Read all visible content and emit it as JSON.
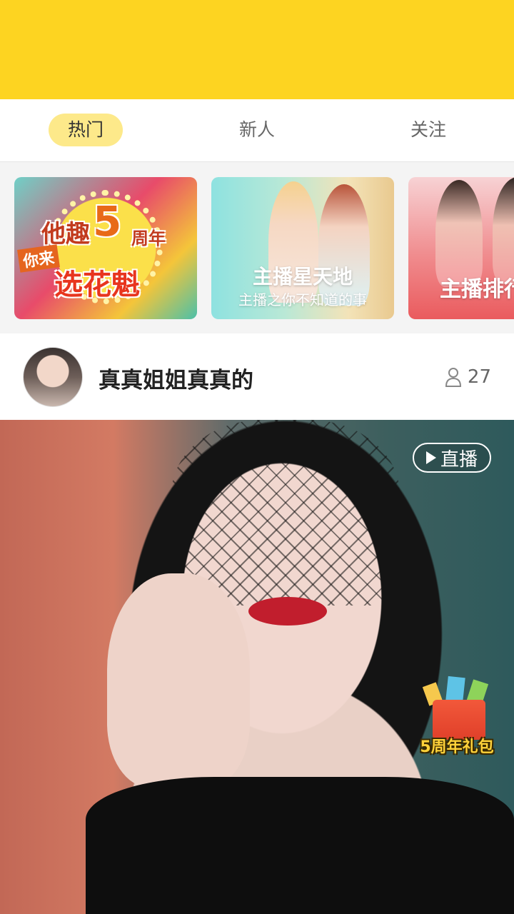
{
  "tabs": [
    {
      "label": "热门",
      "active": true
    },
    {
      "label": "新人",
      "active": false
    },
    {
      "label": "关注",
      "active": false
    }
  ],
  "banners": {
    "banner1": {
      "line1": "他趣",
      "number": "5",
      "line2": "周年",
      "line3": "你来",
      "line4": "选花魁"
    },
    "banner2": {
      "title": "主播星天地",
      "subtitle": "主播之你不知道的事"
    },
    "banner3": {
      "title": "主播排行"
    }
  },
  "stream": {
    "streamer_name": "真真姐姐真真的",
    "viewer_count": "27",
    "live_label": "直播",
    "gift_label": "5周年礼包"
  },
  "colors": {
    "header_yellow": "#FDD421",
    "active_tab_bg": "#FDE98A"
  },
  "icons": {
    "viewer": "person-outline-icon",
    "live": "play-icon"
  }
}
